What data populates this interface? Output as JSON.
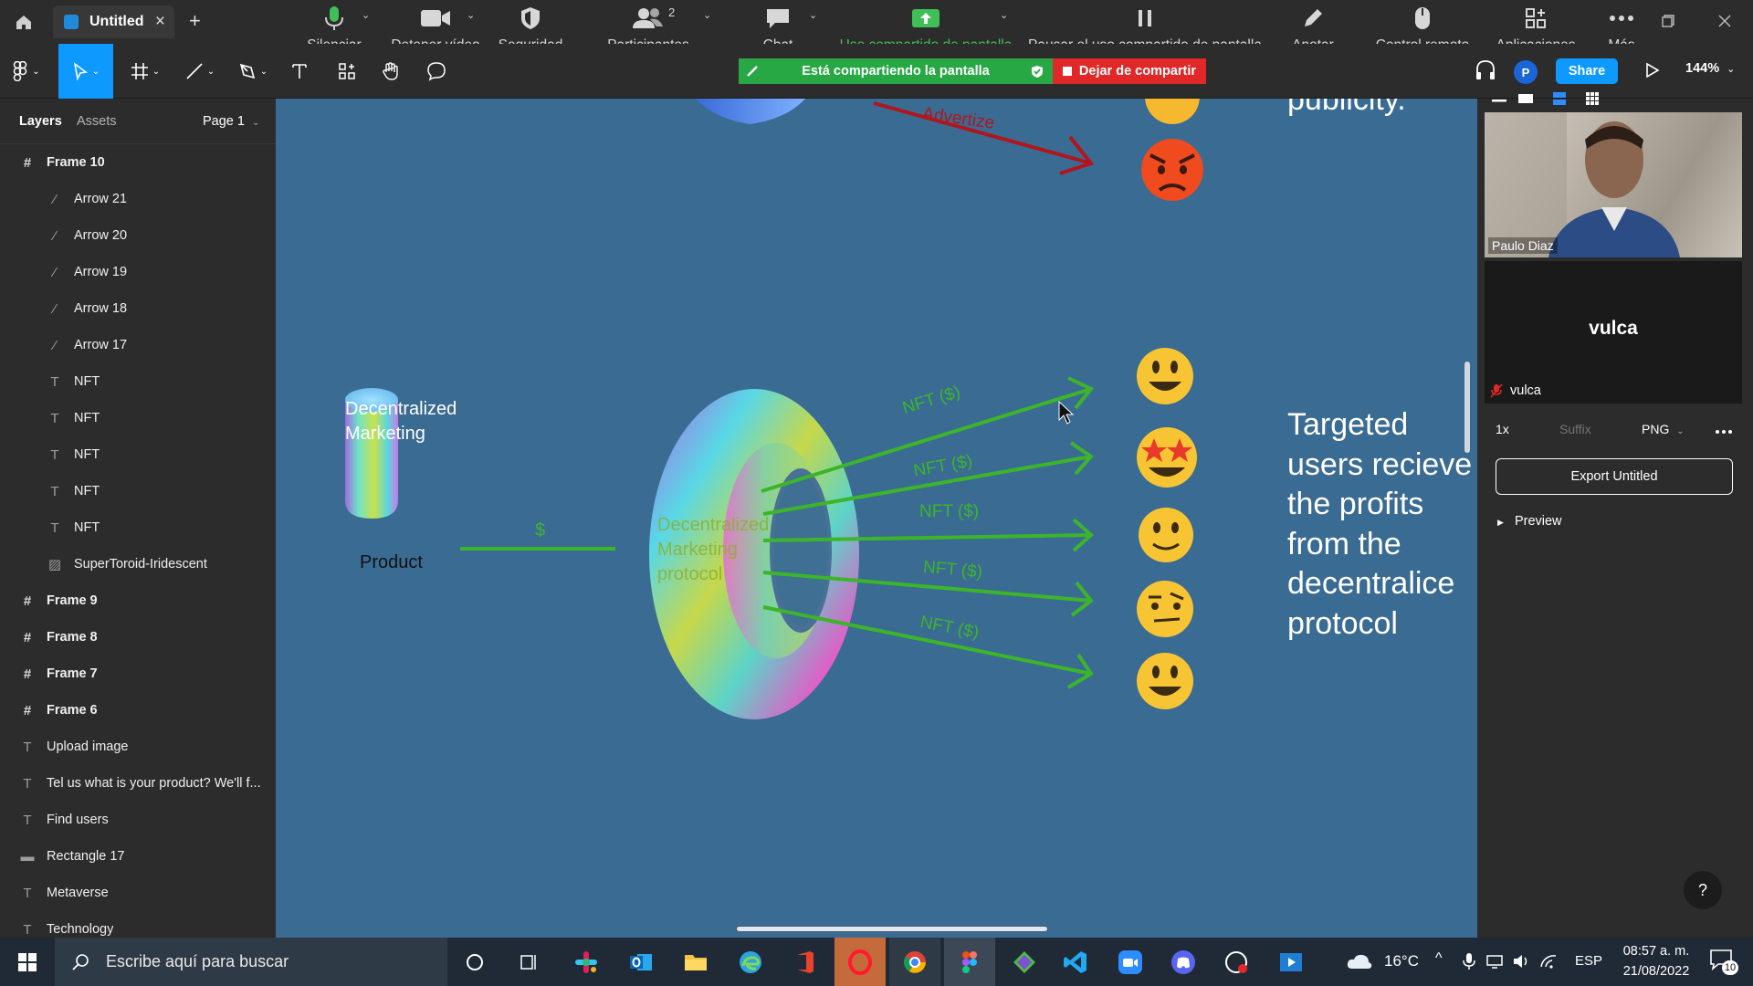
{
  "browser_tab": {
    "title": "Untitled",
    "close": "×",
    "new_tab": "+"
  },
  "zoom_toolbar": {
    "items": [
      {
        "label": "Silenciar",
        "icon": "microphone-icon"
      },
      {
        "label": "Detener vídeo",
        "icon": "video-camera-icon"
      },
      {
        "label": "Seguridad",
        "icon": "shield-icon"
      },
      {
        "label": "Participantes",
        "icon": "participants-icon",
        "count": "2"
      },
      {
        "label": "Chat",
        "icon": "chat-bubble-icon"
      },
      {
        "label": "Uso compartido de pantalla",
        "icon": "share-screen-icon"
      },
      {
        "label": "Pausar el uso compartido de pantalla",
        "icon": "pause-icon"
      },
      {
        "label": "Anotar",
        "icon": "pencil-icon"
      },
      {
        "label": "Control remoto",
        "icon": "mouse-icon"
      },
      {
        "label": "Aplicaciones",
        "icon": "apps-icon"
      },
      {
        "label": "Más",
        "icon": "more-dots-icon"
      }
    ],
    "colors": {
      "share_green": "#3fbf56",
      "text": "#d7d7d7"
    }
  },
  "share_banner": {
    "sharing_text": "Está compartiendo la pantalla",
    "stop_text": "Dejar de compartir"
  },
  "figma_toolbar": {
    "share_label": "Share",
    "zoom_level": "144%",
    "avatar_letter": "P"
  },
  "left_panel": {
    "tabs": {
      "layers": "Layers",
      "assets": "Assets"
    },
    "page": "Page 1",
    "layers": [
      {
        "name": "Frame 10",
        "kind": "frame",
        "indent": 0
      },
      {
        "name": "Arrow 21",
        "kind": "arrow",
        "indent": 1
      },
      {
        "name": "Arrow 20",
        "kind": "arrow",
        "indent": 1
      },
      {
        "name": "Arrow 19",
        "kind": "arrow",
        "indent": 1
      },
      {
        "name": "Arrow 18",
        "kind": "arrow",
        "indent": 1
      },
      {
        "name": "Arrow 17",
        "kind": "arrow",
        "indent": 1
      },
      {
        "name": "NFT",
        "kind": "text",
        "indent": 1
      },
      {
        "name": "NFT",
        "kind": "text",
        "indent": 1
      },
      {
        "name": "NFT",
        "kind": "text",
        "indent": 1
      },
      {
        "name": "NFT",
        "kind": "text",
        "indent": 1
      },
      {
        "name": "NFT",
        "kind": "text",
        "indent": 1
      },
      {
        "name": "SuperToroid-Iridescent",
        "kind": "image",
        "indent": 1
      },
      {
        "name": "Frame 9",
        "kind": "frame",
        "indent": 0
      },
      {
        "name": "Frame 8",
        "kind": "frame",
        "indent": 0
      },
      {
        "name": "Frame 7",
        "kind": "frame",
        "indent": 0
      },
      {
        "name": "Frame 6",
        "kind": "frame",
        "indent": 0
      },
      {
        "name": "Upload image",
        "kind": "text",
        "indent": 0
      },
      {
        "name": "Tel us what is your product? We'll f...",
        "kind": "text",
        "indent": 0
      },
      {
        "name": "Find users",
        "kind": "text",
        "indent": 0
      },
      {
        "name": "Rectangle 17",
        "kind": "rect",
        "indent": 0
      },
      {
        "name": "Metaverse",
        "kind": "text",
        "indent": 0
      },
      {
        "name": "Technology",
        "kind": "text",
        "indent": 0
      }
    ]
  },
  "canvas": {
    "advertize_label": "Advertize",
    "publicity_text": "publicity.",
    "dm_title_line1": "Decentralized",
    "dm_title_line2": "Marketing",
    "product_label": "Product",
    "dollar_label": "$",
    "protocol_label_line1": "Decentralized",
    "protocol_label_line2": "Marketing",
    "protocol_label_line3": "protocol",
    "nft_labels": [
      "NFT ($)",
      "NFT ($)",
      "NFT ($)",
      "NFT ($)",
      "NFT ($)"
    ],
    "targeted_lines": [
      "Targeted",
      "users recieve",
      "the profits",
      "from the",
      "decentralice",
      "protocol"
    ],
    "colors": {
      "background": "#3a6b93",
      "arrow_green": "#3cb52a",
      "arrow_red": "#b0161b"
    }
  },
  "right_panel": {
    "participant_video_name": "Paulo Diaz",
    "participant_name_big": "vulca",
    "participant_name_small": "vulca",
    "export": {
      "scale": "1x",
      "suffix_placeholder": "Suffix",
      "format": "PNG",
      "button": "Export Untitled",
      "preview": "Preview"
    },
    "help": "?"
  },
  "taskbar": {
    "search_placeholder": "Escribe aquí para buscar",
    "temperature": "16°C",
    "language": "ESP",
    "time": "08:57 a. m.",
    "date": "21/08/2022",
    "notifications": "10"
  }
}
